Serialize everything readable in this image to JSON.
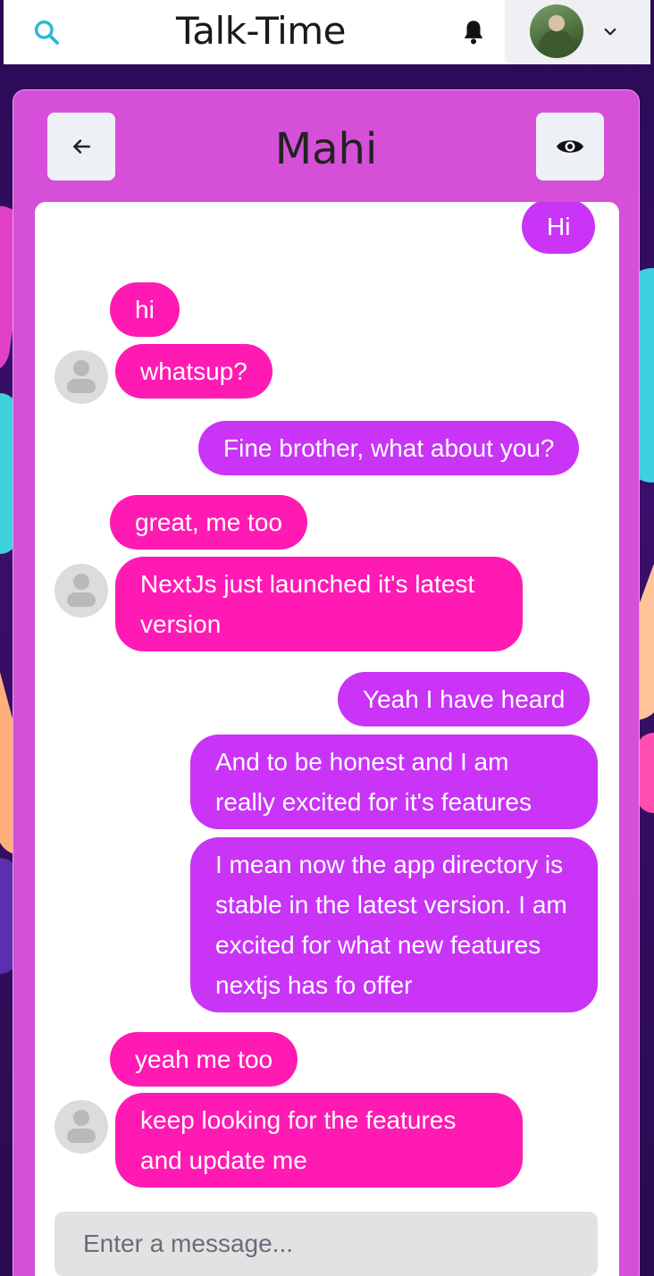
{
  "header": {
    "app_title": "Talk-Time",
    "search_icon": "search-icon",
    "bell_icon": "bell-icon",
    "profile_chevron": "chevron-down-icon"
  },
  "chat": {
    "contact_name": "Mahi",
    "back_icon": "arrow-left-icon",
    "view_icon": "eye-icon",
    "input_placeholder": "Enter a message...",
    "colors": {
      "card": "#d54fd8",
      "outgoing": "#c934f6",
      "incoming": "#ff1ab3"
    },
    "messages": [
      {
        "dir": "out",
        "text": "Hi"
      },
      {
        "dir": "in",
        "text": "hi"
      },
      {
        "dir": "in",
        "text": "whatsup?"
      },
      {
        "dir": "out",
        "text": "Fine brother, what about you?"
      },
      {
        "dir": "in",
        "text": "great, me too"
      },
      {
        "dir": "in",
        "text": "NextJs just launched it's latest version"
      },
      {
        "dir": "out",
        "text": "Yeah I have heard"
      },
      {
        "dir": "out",
        "text": "And to be honest and I am really excited for it's features"
      },
      {
        "dir": "out",
        "text": "I mean now the app directory is stable in the latest version. I am excited for what new features nextjs has fo offer"
      },
      {
        "dir": "in",
        "text": "yeah me too"
      },
      {
        "dir": "in",
        "text": "keep looking for the features and update me"
      }
    ]
  }
}
